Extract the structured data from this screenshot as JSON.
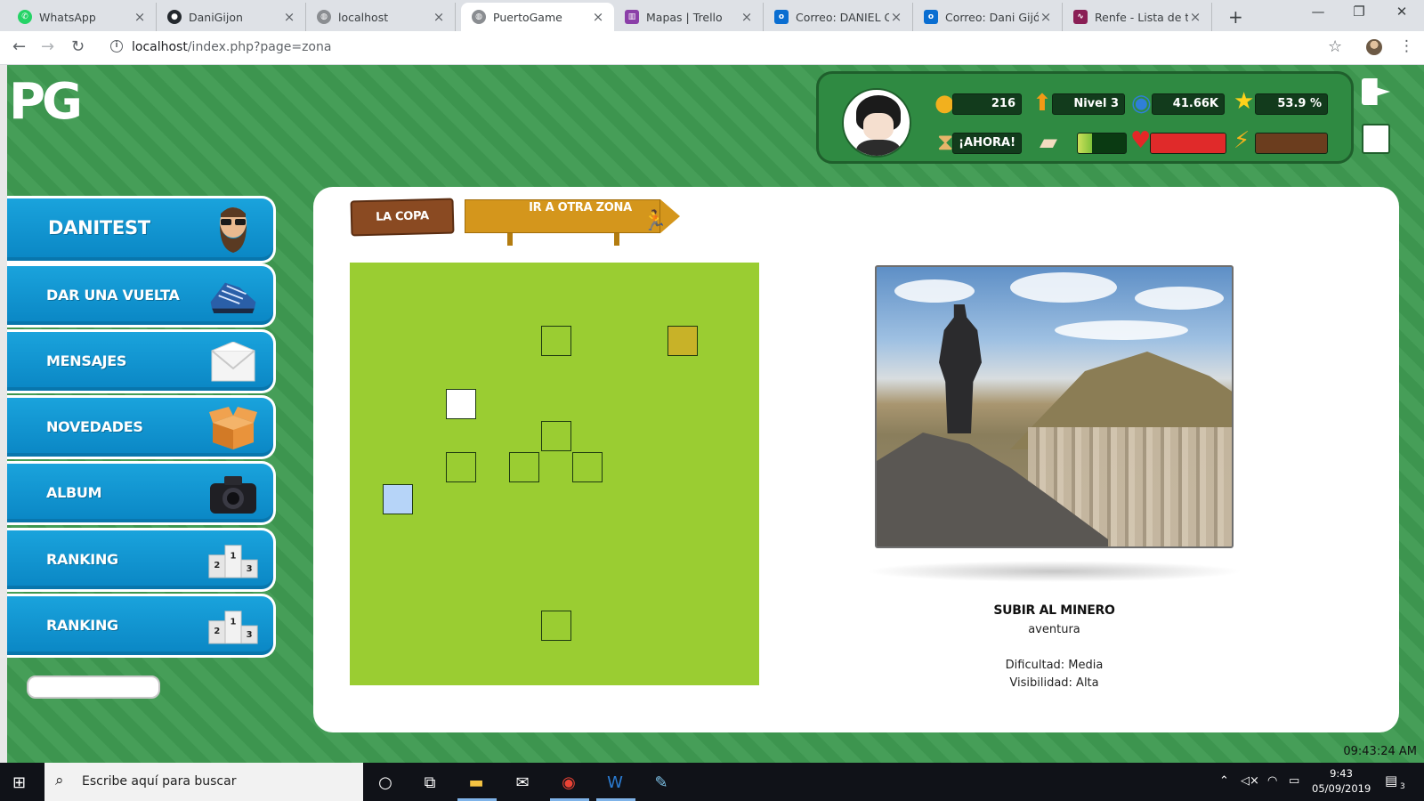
{
  "browser": {
    "tabs": [
      {
        "title": "WhatsApp",
        "icon": "whatsapp-icon",
        "color": "#25d366"
      },
      {
        "title": "DaniGijon",
        "icon": "github-icon",
        "color": "#24292e"
      },
      {
        "title": "localhost",
        "icon": "globe-icon",
        "color": "#5f6368"
      },
      {
        "title": "PuertoGame",
        "icon": "globe-icon",
        "color": "#5f6368",
        "active": true
      },
      {
        "title": "Mapas | Trello",
        "icon": "trello-icon",
        "color": "#8b3fa8"
      },
      {
        "title": "Correo: DANIEL Gi",
        "icon": "outlook-icon",
        "color": "#0a6ed1"
      },
      {
        "title": "Correo: Dani Gijón",
        "icon": "outlook-icon",
        "color": "#0a6ed1"
      },
      {
        "title": "Renfe - Lista de tre",
        "icon": "renfe-icon",
        "color": "#8a1f55"
      }
    ],
    "url_host": "localhost",
    "url_path": "/index.php?page=zona"
  },
  "hud": {
    "coins": "216",
    "level": "Nivel 3",
    "world": "41.66K",
    "percent": "53.9 %",
    "timer": "¡AHORA!",
    "book_progress": 0.3,
    "health_progress": 1.0,
    "energy_progress": 0.0
  },
  "logo": "PG",
  "menu": [
    {
      "label": "DANITEST",
      "icon": "bearded-man-icon"
    },
    {
      "label": "DAR UNA VUELTA",
      "icon": "sneaker-icon"
    },
    {
      "label": "MENSAJES",
      "icon": "envelope-icon"
    },
    {
      "label": "NOVEDADES",
      "icon": "box-icon"
    },
    {
      "label": "ALBUM",
      "icon": "camera-icon"
    },
    {
      "label": "RANKING",
      "icon": "podium-icon"
    },
    {
      "label": "RANKING",
      "icon": "podium-icon"
    }
  ],
  "signs": {
    "copa": "LA COPA",
    "otra_zona": "IR A OTRA ZONA"
  },
  "zone": {
    "title": "SUBIR AL MINERO",
    "type": "aventura",
    "difficulty": "Dificultad: Media",
    "visibility": "Visibilidad: Alta"
  },
  "clock": "09:43:24 AM",
  "taskbar": {
    "search_placeholder": "Escribe aquí para buscar",
    "time": "9:43",
    "date": "05/09/2019",
    "notifications": "3"
  },
  "colors": {
    "page_green": "#3f9a52",
    "menu_blue": "#0a86c4",
    "grid_green": "#9acd32",
    "cell_gold": "#c8b228",
    "cell_white": "#ffffff",
    "cell_blue": "#b6d4f8"
  }
}
